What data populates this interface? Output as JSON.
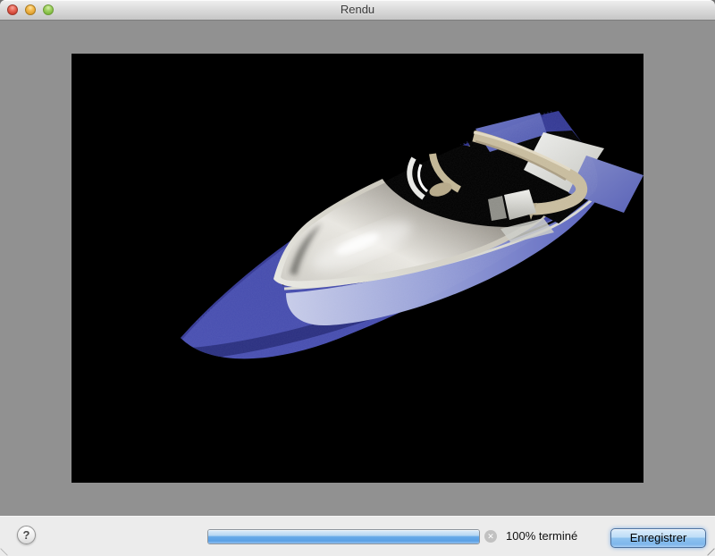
{
  "window": {
    "title": "Rendu",
    "traffic_lights": [
      "close",
      "minimize",
      "zoom"
    ]
  },
  "render": {
    "subject": "3D render of a speedboat on black background",
    "colors": {
      "canvas_background": "#000000",
      "hull_blue": "#454cae",
      "hull_light_band": "#9aa2d8",
      "deck_silver_light": "#eceae4",
      "deck_silver_dark": "#1a1918",
      "cockpit_trim_tan": "#c9bda1",
      "swim_platform": "#dddcd6"
    }
  },
  "footer": {
    "help_label": "?",
    "progress_percent": 100,
    "status_text": "100% terminé",
    "cancel_icon_glyph": "✕",
    "save_label": "Enregistrer",
    "progress_color": "#66a9e8"
  }
}
